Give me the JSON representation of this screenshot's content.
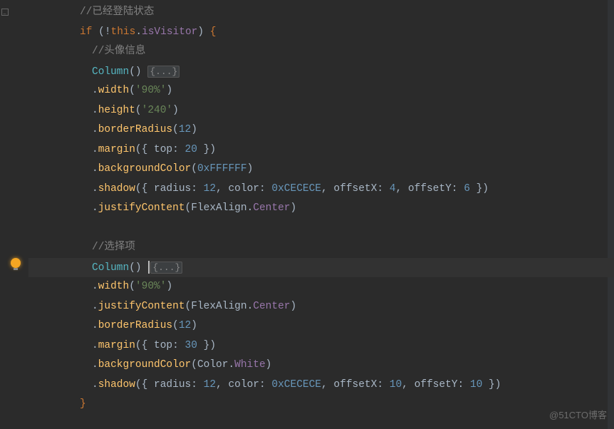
{
  "editor": {
    "watermark": "@51CTO博客",
    "lines": {
      "c1": "//已经登陆状态",
      "if_kw": "if",
      "if_paren_o": " (",
      "if_not": "!",
      "if_this": "this",
      "if_dot": ".",
      "if_prop": "isVisitor",
      "if_paren_c": ")",
      "if_brace": " {",
      "c2": "//头像信息",
      "col1": "Column",
      "paren_pair": "()",
      "fold": "{...}",
      "dot": ".",
      "width_fn": "width",
      "width_v": "'90%'",
      "height_fn": "height",
      "height_v": "'240'",
      "br_fn": "borderRadius",
      "br_v": "12",
      "mg_fn": "margin",
      "mg_obj_o": "({ ",
      "mg_top": "top",
      "mg_colon": ": ",
      "mg_v1": "20",
      "mg_obj_c": " })",
      "bg_fn": "backgroundColor",
      "bg_hex": "0xFFFFFF",
      "sh_fn": "shadow",
      "sh_o": "({ ",
      "sh_radius": "radius",
      "sh_rv": "12",
      "sh_sep": ", ",
      "sh_color": "color",
      "sh_cv": "0xCECECE",
      "sh_ox": "offsetX",
      "sh_oxv": "4",
      "sh_oy": "offsetY",
      "sh_oyv": "6",
      "sh_c": " })",
      "jc_fn": "justifyContent",
      "fa": "FlexAlign",
      "fa_center": "Center",
      "c3": "//选择项",
      "mg_v2": "30",
      "bg2_cls": "Color",
      "bg2_white": "White",
      "sh2_oxv": "10",
      "sh2_oyv": "10",
      "close_brace": "}"
    }
  }
}
